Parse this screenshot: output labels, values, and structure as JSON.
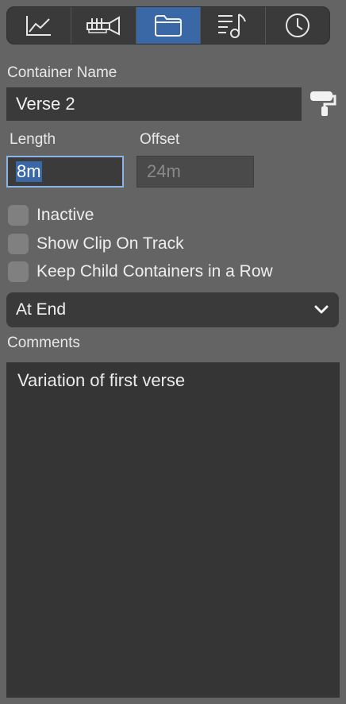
{
  "tabs": [
    {
      "icon": "line-chart-icon"
    },
    {
      "icon": "trumpet-icon"
    },
    {
      "icon": "folder-icon",
      "active": true
    },
    {
      "icon": "music-list-icon"
    },
    {
      "icon": "clock-icon"
    }
  ],
  "container_name": {
    "label": "Container Name",
    "value": "Verse 2",
    "paint_icon": "paint-roller-icon"
  },
  "length": {
    "label": "Length",
    "value": "8m"
  },
  "offset": {
    "label": "Offset",
    "value": "24m"
  },
  "options": [
    {
      "label": "Inactive",
      "checked": false
    },
    {
      "label": "Show Clip On Track",
      "checked": false
    },
    {
      "label": "Keep Child Containers in a Row",
      "checked": false
    }
  ],
  "position_select": {
    "value": "At End"
  },
  "comments": {
    "label": "Comments",
    "value": "Variation of first verse"
  },
  "colors": {
    "accent": "#3a67a6",
    "background": "#646464",
    "field": "#3a3a3a"
  }
}
